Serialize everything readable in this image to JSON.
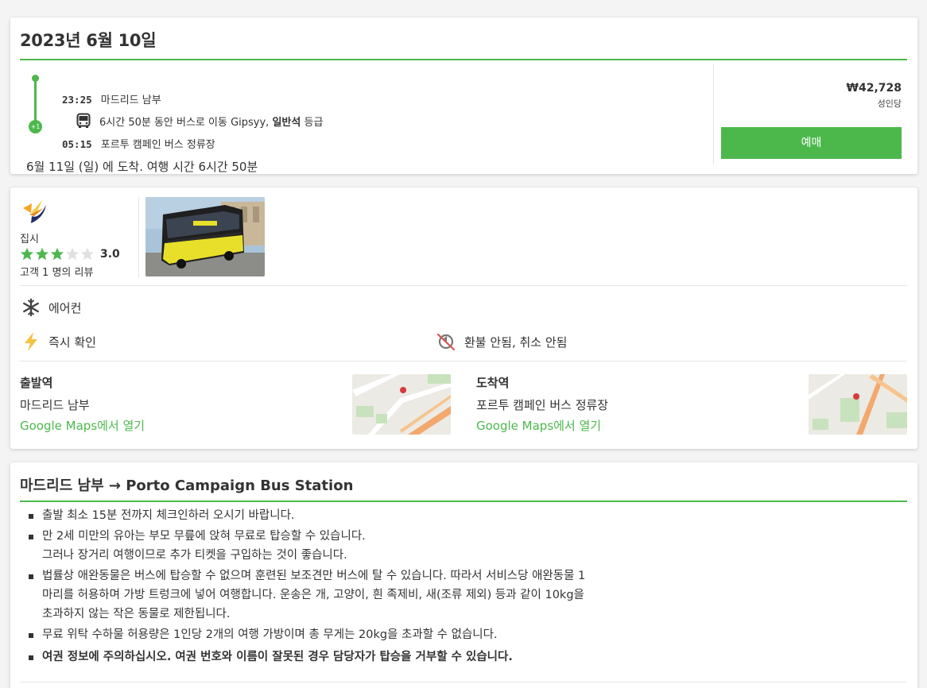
{
  "trip": {
    "date_title": "2023년 6월 10일",
    "departure_time": "23:25",
    "departure_station": "마드리드 남부",
    "duration_prefix": "6시간 50분 동안 버스로 이동 Gipsyy,",
    "seat_class": "일반석",
    "seat_suffix": "등급",
    "day_offset": "+1",
    "arrival_time": "05:15",
    "arrival_station": "포르투 캠페인 버스 정류장",
    "arrival_note": "6월 11일 (일) 에 도착. 여행 시간 6시간 50분",
    "price": "₩42,728",
    "price_unit": "성인당",
    "book_label": "예매"
  },
  "operator": {
    "name": "집시",
    "rating": 3,
    "max_rating": 5,
    "rating_label": "3.0",
    "reviews": "고객 1 명의 리뷰",
    "amenity_ac": "에어컨",
    "amenity_instant": "즉시 확인",
    "amenity_refund": "환불 안됨, 취소 안됨",
    "icons": [
      "operator-logo",
      "snowflake-icon",
      "lightning-icon",
      "no-refund-icon"
    ]
  },
  "stations": {
    "departure_title": "출발역",
    "departure_name": "마드리드 남부",
    "departure_link": "Google Maps에서 열기",
    "arrival_title": "도착역",
    "arrival_name": "포르투 캠페인 버스 정류장",
    "arrival_link": "Google Maps에서 열기"
  },
  "info": {
    "title": "마드리드 남부 → Porto Campaign Bus Station",
    "rules": [
      "출발 최소 15분 전까지 체크인하러 오시기 바랍니다.",
      "만 2세 미만의 유아는 부모 무릎에 앉혀 무료로 탑승할 수 있습니다.",
      "그러나 장거리 여행이므로 추가 티켓을 구입하는 것이 좋습니다.",
      "법률상 애완동물은 버스에 탑승할 수 없으며 훈련된 보조견만 버스에 탈 수 있습니다. 따라서 서비스당 애완동물 1",
      "마리를 허용하며 가방 트렁크에 넣어 여행합니다. 운송은 개, 고양이, 흰 족제비, 새(조류 제외) 등과 같이 10kg을",
      "초과하지 않는 작은 동물로 제한됩니다.",
      "무료 위탁 수하물 허용량은 1인당 2개의 여행 가방이며 총 무게는 20kg을 초과할 수 없습니다.",
      "여권 정보에 주의하십시오. 여권 번호와 이름이 잘못된 경우 담당자가 탑승을 거부할 수 있습니다."
    ]
  },
  "colors": {
    "accent": "#4cb84c",
    "star_off": "#e0e0e0",
    "lightning": "#f5c242"
  }
}
